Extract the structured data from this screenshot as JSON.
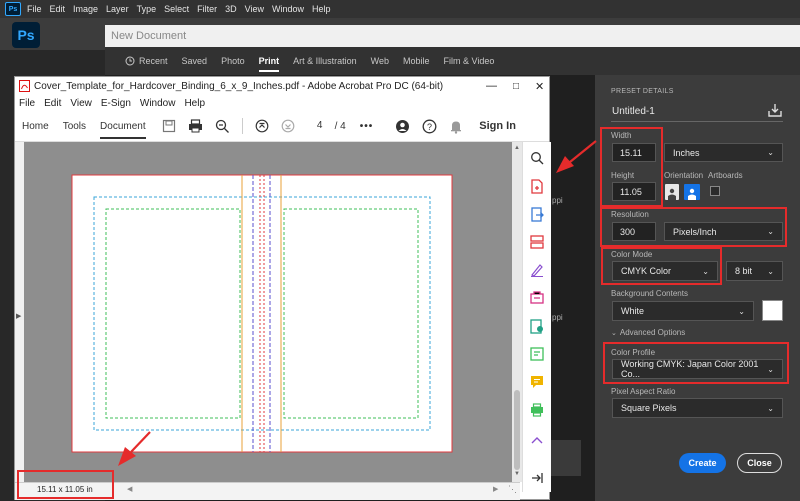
{
  "photoshop": {
    "logo": "Ps",
    "menu": [
      "File",
      "Edit",
      "Image",
      "Layer",
      "Type",
      "Select",
      "Filter",
      "3D",
      "View",
      "Window",
      "Help"
    ]
  },
  "new_document": {
    "title": "New Document",
    "tabs": [
      "Recent",
      "Saved",
      "Photo",
      "Print",
      "Art & Illustration",
      "Web",
      "Mobile",
      "Film & Video"
    ],
    "active_tab": "Print",
    "partial_labels": [
      "ppi",
      "ppi"
    ]
  },
  "preset": {
    "section_title": "PRESET DETAILS",
    "name": "Untitled-1",
    "width_label": "Width",
    "width_value": "15.11",
    "units": "Inches",
    "height_label": "Height",
    "height_value": "11.05",
    "orientation_label": "Orientation",
    "artboards_label": "Artboards",
    "resolution_label": "Resolution",
    "resolution_value": "300",
    "resolution_units": "Pixels/Inch",
    "color_mode_label": "Color Mode",
    "color_mode_value": "CMYK Color",
    "bit_depth": "8 bit",
    "background_label": "Background Contents",
    "background_value": "White",
    "advanced_label": "Advanced Options",
    "color_profile_label": "Color Profile",
    "color_profile_value": "Working CMYK: Japan Color 2001 Co...",
    "pixel_aspect_label": "Pixel Aspect Ratio",
    "pixel_aspect_value": "Square Pixels",
    "create_label": "Create",
    "close_label": "Close"
  },
  "acrobat": {
    "title": "Cover_Template_for_Hardcover_Binding_6_x_9_Inches.pdf - Adobe Acrobat Pro DC (64-bit)",
    "menu": [
      "File",
      "Edit",
      "View",
      "E-Sign",
      "Window",
      "Help"
    ],
    "tabs": [
      "Home",
      "Tools",
      "Document"
    ],
    "active_tab": "Document",
    "page_current": "4",
    "page_total": "/ 4",
    "sign_in": "Sign In",
    "page_size": "15.11 x 11.05 in"
  },
  "colors": {
    "highlight": "#e52b2b",
    "accent_blue": "#1473e6",
    "guide_red": "#e0393e",
    "guide_cyan": "#38a6d8",
    "guide_green": "#3fbf5a",
    "guide_orange": "#e8a23a",
    "guide_purple": "#5a4fcf"
  }
}
